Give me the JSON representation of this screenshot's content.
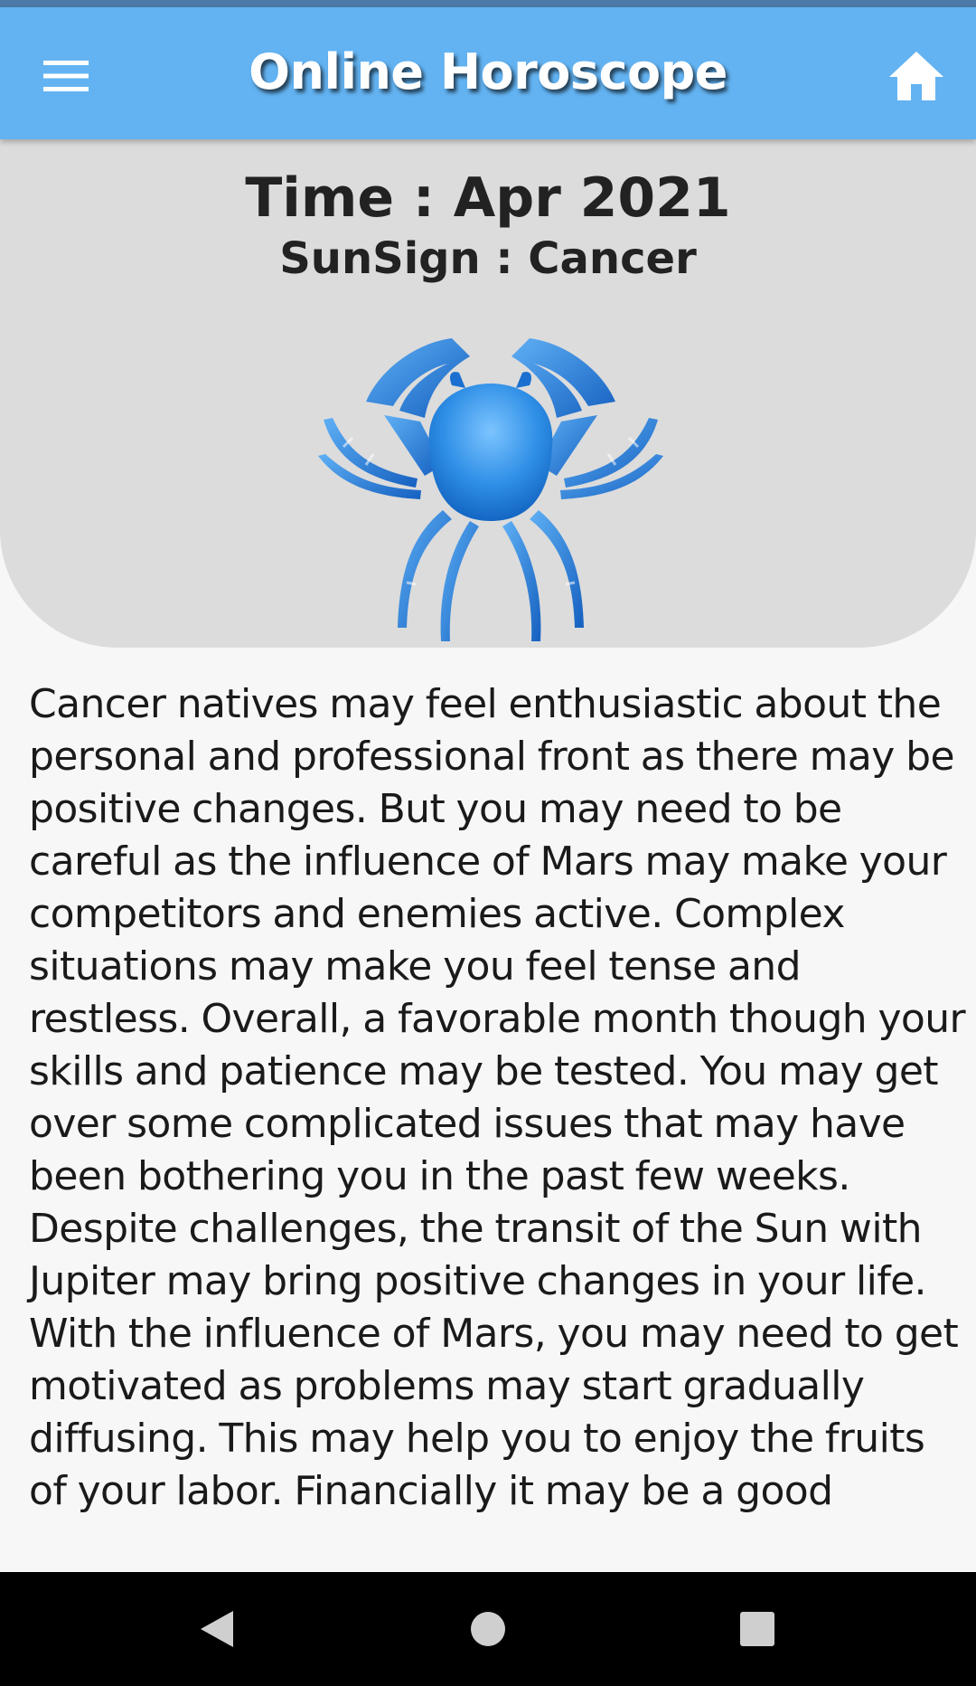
{
  "app_bar": {
    "title": "Online Horoscope",
    "background_color": "#63b3f2",
    "menu_icon": "hamburger-menu-icon",
    "home_icon": "home-icon"
  },
  "header": {
    "time_text": "Time : Apr 2021",
    "sunsign_text": "SunSign : Cancer",
    "sign_image": "cancer-crab-icon",
    "sign_color": "#2a82e0",
    "card_color": "#dcdcdc"
  },
  "content": {
    "description": "Cancer natives may feel enthusiastic about the personal and professional front as there may be positive changes. But you may need to be careful as the influence of Mars may make your competitors and enemies active. Complex situations may make you feel tense and restless. Overall, a favorable month though your skills and patience may be tested. You may get over some complicated issues that may have been bothering you in the past few weeks. Despite challenges, the transit of the Sun with Jupiter may bring positive changes in your life. With the influence of Mars, you may need to get motivated as problems may start gradually diffusing. This may help you to enjoy the fruits of your labor. Financially it may be a good"
  },
  "system_nav": {
    "back_icon": "back-triangle-icon",
    "home_icon": "home-circle-icon",
    "recents_icon": "recents-square-icon"
  }
}
